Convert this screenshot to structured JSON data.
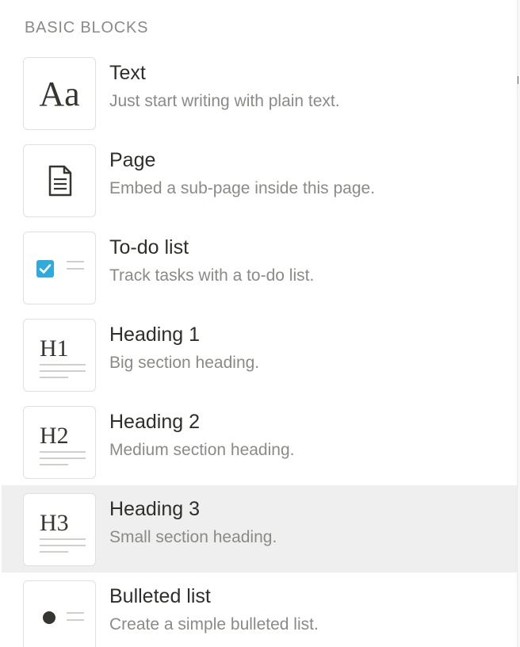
{
  "section": {
    "header": "BASIC BLOCKS"
  },
  "items": [
    {
      "title": "Text",
      "description": "Just start writing with plain text.",
      "icon": "text-aa-icon",
      "glyph": "Aa"
    },
    {
      "title": "Page",
      "description": "Embed a sub-page inside this page.",
      "icon": "page-document-icon"
    },
    {
      "title": "To-do list",
      "description": "Track tasks with a to-do list.",
      "icon": "todo-checkbox-icon"
    },
    {
      "title": "Heading 1",
      "description": "Big section heading.",
      "icon": "heading-1-icon",
      "glyph": "H1"
    },
    {
      "title": "Heading 2",
      "description": "Medium section heading.",
      "icon": "heading-2-icon",
      "glyph": "H2"
    },
    {
      "title": "Heading 3",
      "description": "Small section heading.",
      "icon": "heading-3-icon",
      "glyph": "H3",
      "selected": true
    },
    {
      "title": "Bulleted list",
      "description": "Create a simple bulleted list.",
      "icon": "bulleted-list-icon"
    }
  ],
  "colors": {
    "checkbox_accent": "#2eaadc",
    "selected_background": "#efefef",
    "text_primary": "#2f2e2b",
    "text_secondary": "#8b8a86"
  }
}
